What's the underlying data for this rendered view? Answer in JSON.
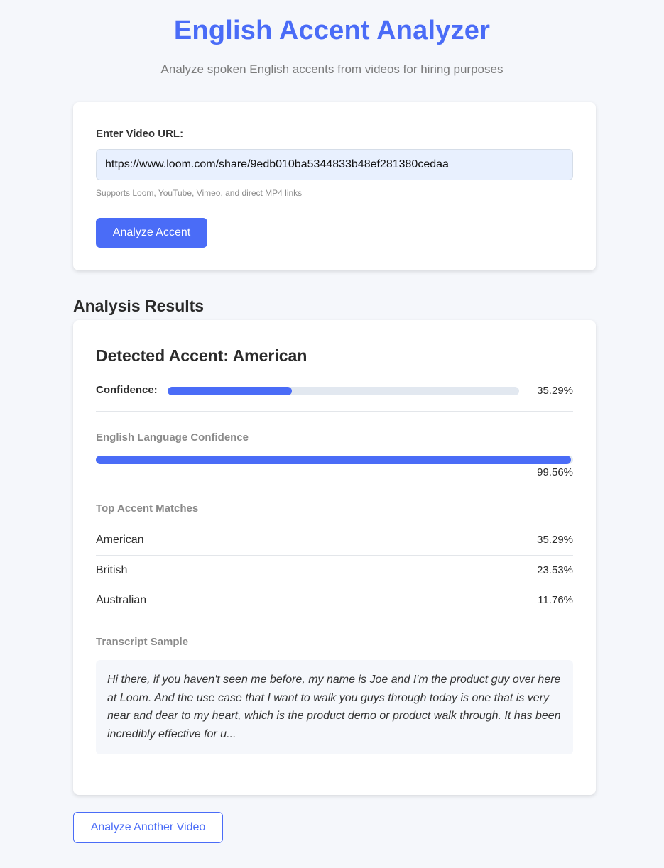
{
  "header": {
    "title": "English Accent Analyzer",
    "subtitle": "Analyze spoken English accents from videos for hiring purposes"
  },
  "input_card": {
    "label": "Enter Video URL:",
    "url_value": "https://www.loom.com/share/9edb010ba5344833b48ef281380cedaa",
    "hint": "Supports Loom, YouTube, Vimeo, and direct MP4 links",
    "analyze_label": "Analyze Accent"
  },
  "results": {
    "heading": "Analysis Results",
    "detected_accent": "Detected Accent: American",
    "confidence_label": "Confidence:",
    "confidence_value": "35.29%",
    "confidence_fraction": 0.3529,
    "english_label": "English Language Confidence",
    "english_value": "99.56%",
    "english_fraction": 0.9956,
    "top_matches_label": "Top Accent Matches",
    "top_matches": [
      {
        "name": "American",
        "value": "35.29%"
      },
      {
        "name": "British",
        "value": "23.53%"
      },
      {
        "name": "Australian",
        "value": "11.76%"
      }
    ],
    "transcript_label": "Transcript Sample",
    "transcript": "Hi there, if you haven't seen me before, my name is Joe and I'm the product guy over here at Loom. And the use case that I want to walk you guys through today is one that is very near and dear to my heart, which is the product demo or product walk through. It has been incredibly effective for u..."
  },
  "footer": {
    "another_label": "Analyze Another Video"
  },
  "colors": {
    "accent": "#4a6cf7",
    "track": "#e2e8f0",
    "background": "#f5f7fb"
  }
}
